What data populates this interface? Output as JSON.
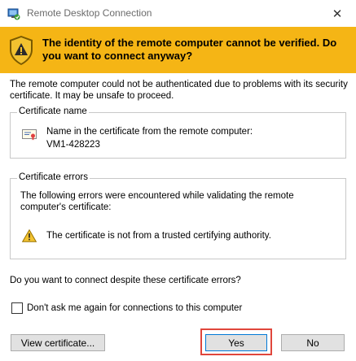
{
  "window": {
    "title": "Remote Desktop Connection",
    "close_glyph": "✕"
  },
  "banner": {
    "message": "The identity of the remote computer cannot be verified. Do you want to connect anyway?",
    "color": "#f5b515"
  },
  "intro": "The remote computer could not be authenticated due to problems with its security certificate. It may be unsafe to proceed.",
  "certificate_name": {
    "title": "Certificate name",
    "label": "Name in the certificate from the remote computer:",
    "value": "VM1-428223",
    "icon": "certificate-icon"
  },
  "certificate_errors": {
    "title": "Certificate errors",
    "description": "The following errors were encountered while validating the remote computer's certificate:",
    "errors": [
      {
        "icon": "warning-icon",
        "text": "The certificate is not from a trusted certifying authority."
      }
    ]
  },
  "question": "Do you want to connect despite these certificate errors?",
  "dont_ask": {
    "label": "Don't ask me again for connections to this computer",
    "checked": false
  },
  "buttons": {
    "view_certificate": "View certificate...",
    "yes": "Yes",
    "no": "No"
  },
  "highlight_color": "#e0463c"
}
